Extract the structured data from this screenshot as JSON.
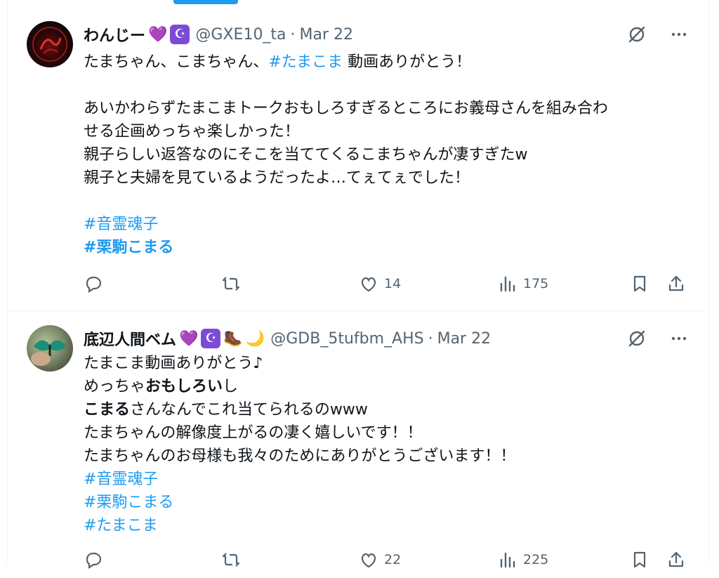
{
  "tweets": [
    {
      "name": "わんじー",
      "badges": [
        "💜",
        "☪"
      ],
      "handle": "@GXE10_ta",
      "separator": "·",
      "date": "Mar 22",
      "lines": {
        "l1_a": "たまちゃん、こまちゃん、",
        "l1_tag": "#たまこま",
        "l1_b": " 動画ありがとう！",
        "l2": "あいかわらずたまこまトークおもしろすぎるところにお義母さんを組み合わ",
        "l3": "せる企画めっちゃ楽しかった！",
        "l4": "親子らしい返答なのにそこを当ててくるこまちゃんが凄すぎたw",
        "l5": "親子と夫婦を見ているようだったよ…てぇてぇでした！",
        "tag1": "#音霊魂子",
        "tag2": "#栗駒こまる"
      },
      "likes": "14",
      "views": "175"
    },
    {
      "name": "底辺人間ベム",
      "badges": [
        "💜",
        "☪",
        "🥾",
        "🌙"
      ],
      "handle": "@GDB_5tufbm_AHS",
      "separator": "·",
      "date": "Mar 22",
      "lines": {
        "l1": "たまこま動画ありがとう♪",
        "l2_a": "めっちゃ",
        "l2_bold": "おもしろい",
        "l2_b": "し",
        "l3_bold": "こまる",
        "l3_b": "さんなんでこれ当てられるのwww",
        "l4": "たまちゃんの解像度上がるの凄く嬉しいです！！",
        "l5": "たまちゃんのお母様も我々のためにありがとうございます！！",
        "tag1": "#音霊魂子",
        "tag2": "#栗駒こまる",
        "tag3": "#たまこま"
      },
      "likes": "22",
      "views": "225"
    }
  ],
  "icons": [
    "grok-icon",
    "more-icon",
    "reply-icon",
    "retweet-icon",
    "like-icon",
    "views-icon",
    "bookmark-icon",
    "share-icon"
  ],
  "colors": {
    "accent": "#1d9bf0",
    "secondary_text": "#536471",
    "primary_text": "#0f1419",
    "divider": "#eff3f4"
  }
}
